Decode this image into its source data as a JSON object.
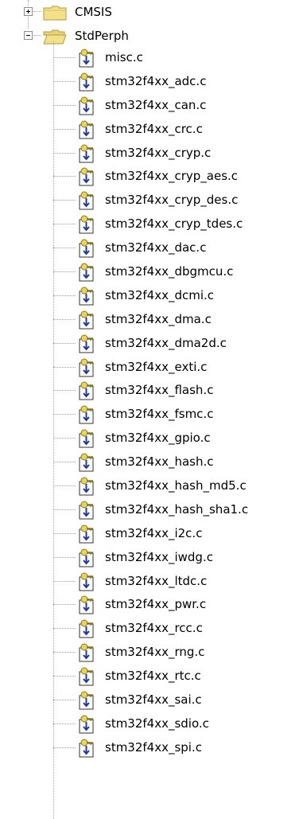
{
  "tree": {
    "folders": [
      {
        "label": "CMSIS",
        "state": "collapsed",
        "icon": "folder-closed-icon"
      },
      {
        "label": "StdPerph",
        "state": "expanded",
        "icon": "folder-open-icon"
      }
    ],
    "files": [
      "misc.c",
      "stm32f4xx_adc.c",
      "stm32f4xx_can.c",
      "stm32f4xx_crc.c",
      "stm32f4xx_cryp.c",
      "stm32f4xx_cryp_aes.c",
      "stm32f4xx_cryp_des.c",
      "stm32f4xx_cryp_tdes.c",
      "stm32f4xx_dac.c",
      "stm32f4xx_dbgmcu.c",
      "stm32f4xx_dcmi.c",
      "stm32f4xx_dma.c",
      "stm32f4xx_dma2d.c",
      "stm32f4xx_exti.c",
      "stm32f4xx_flash.c",
      "stm32f4xx_fsmc.c",
      "stm32f4xx_gpio.c",
      "stm32f4xx_hash.c",
      "stm32f4xx_hash_md5.c",
      "stm32f4xx_hash_sha1.c",
      "stm32f4xx_i2c.c",
      "stm32f4xx_iwdg.c",
      "stm32f4xx_ltdc.c",
      "stm32f4xx_pwr.c",
      "stm32f4xx_rcc.c",
      "stm32f4xx_rng.c",
      "stm32f4xx_rtc.c",
      "stm32f4xx_sai.c",
      "stm32f4xx_sdio.c",
      "stm32f4xx_spi.c"
    ],
    "file_icon": "c-source-file-icon",
    "colors": {
      "folder_fill": "#f3e08a",
      "folder_stroke": "#b79a3c",
      "file_arrow": "#1f3a9e",
      "connector": "#a0a0a0"
    }
  }
}
